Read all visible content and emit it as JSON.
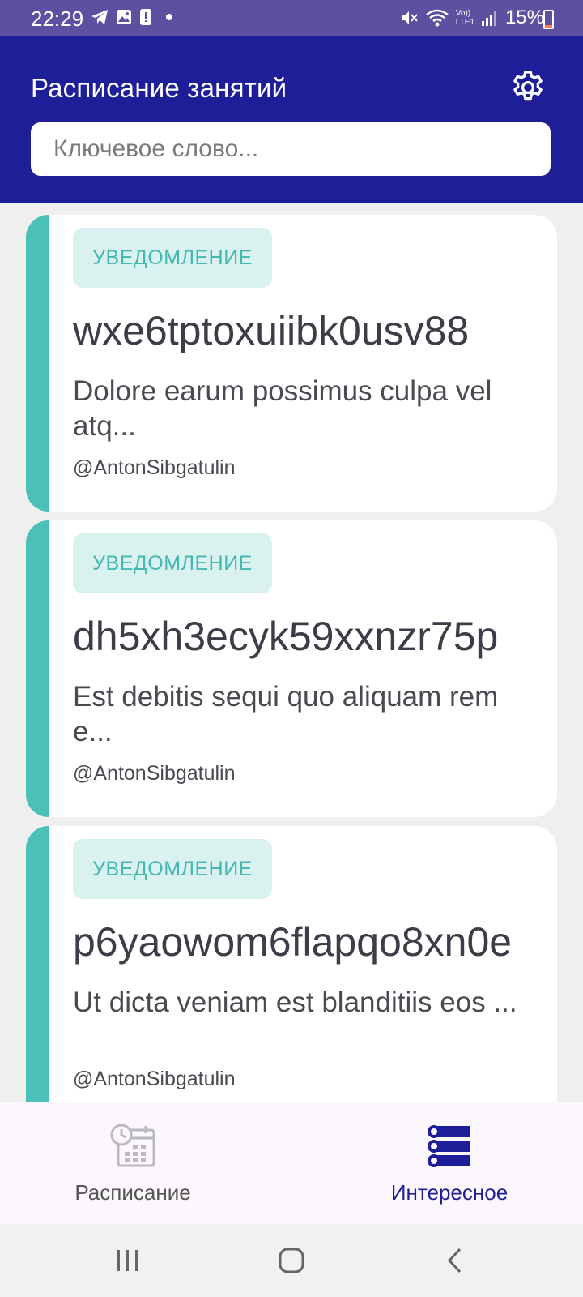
{
  "status_bar": {
    "time": "22:29",
    "battery_percent": "15%",
    "battery_level": 0.15,
    "icons": [
      "telegram-icon",
      "gallery-icon",
      "alert-icon",
      "dot-icon",
      "mute-icon",
      "wifi-icon",
      "volte-icon",
      "signal-icon",
      "battery-icon"
    ],
    "network_label_top": "Vo))",
    "network_label_bottom": "LTE1"
  },
  "app_bar": {
    "title": "Расписание занятий",
    "settings_icon": "gear-icon",
    "search_placeholder": "Ключевое слово..."
  },
  "cards": [
    {
      "badge": "УВЕДОМЛЕНИЕ",
      "title": "wxe6tptoxuiibk0usv88",
      "description": "Dolore earum possimus culpa vel atq...",
      "author": "@AntonSibgatulin"
    },
    {
      "badge": "УВЕДОМЛЕНИЕ",
      "title": "dh5xh3ecyk59xxnzr75p",
      "description": "Est debitis sequi quo aliquam rem e...",
      "author": "@AntonSibgatulin"
    },
    {
      "badge": "УВЕДОМЛЕНИЕ",
      "title": "p6yaowom6flapqo8xn0e",
      "description": "Ut dicta veniam est blanditiis eos ...",
      "author": "@AntonSibgatulin"
    }
  ],
  "bottom_nav": {
    "items": [
      {
        "label": "Расписание",
        "icon": "calendar-clock-icon",
        "selected": false
      },
      {
        "label": "Интересное",
        "icon": "list-icon",
        "selected": true
      }
    ]
  },
  "colors": {
    "status_bar": "#5f4fa0",
    "app_bar": "#1e1e99",
    "accent_teal": "#4bbfb8",
    "badge_bg": "#d9f1ef",
    "nav_selected": "#1e1e99"
  },
  "system_nav": {
    "buttons": [
      "recents-icon",
      "home-icon",
      "back-icon"
    ]
  }
}
